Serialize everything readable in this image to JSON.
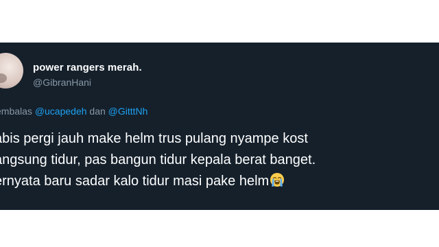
{
  "tweet": {
    "display_name": "power rangers merah.",
    "handle": "@GibranHani",
    "reply": {
      "prefix": "embalas ",
      "mention_1": "@ucapedeh",
      "connector": " dan ",
      "mention_2": "@GitttNh"
    },
    "text_lines": [
      "abis pergi jauh make helm trus pulang nyampe kost",
      "angsung tidur, pas bangun tidur kepala berat banget.",
      "ernyata baru sadar kalo tidur masi pake helm"
    ],
    "emoji": "loudly-crying-face-icon"
  },
  "colors": {
    "background": "#15202b",
    "text": "#ffffff",
    "secondary": "#8899a6",
    "link": "#1da1f2"
  }
}
